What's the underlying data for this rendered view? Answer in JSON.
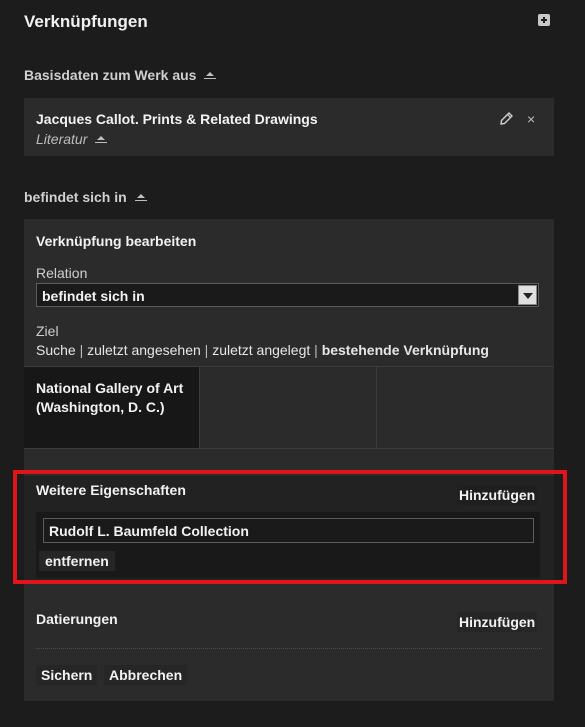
{
  "header": {
    "title": "Verknüpfungen"
  },
  "section1": {
    "label": "Basisdaten zum Werk aus",
    "item": {
      "title": "Jacques Callot. Prints & Related Drawings",
      "subtitle": "Literatur",
      "close": "×"
    }
  },
  "section2": {
    "label": "befindet sich in",
    "editor": {
      "title": "Verknüpfung bearbeiten",
      "relation_label": "Relation",
      "relation_value": "befindet sich in",
      "target_label": "Ziel",
      "links": [
        "Suche",
        "zuletzt angesehen",
        "zuletzt angelegt",
        "bestehende Verknüpfung"
      ],
      "separator": "|",
      "selected_result": "National Gallery of Art (Washington, D. C.)"
    },
    "weitere": {
      "title": "Weitere Eigenschaften",
      "add_label": "Hinzufügen",
      "value": "Rudolf L. Baumfeld Collection",
      "remove_label": "entfernen"
    },
    "datierungen": {
      "title": "Datierungen",
      "add_label": "Hinzufügen"
    },
    "actions": {
      "save": "Sichern",
      "cancel": "Abbrechen"
    }
  },
  "highlight_color": "#e0151b",
  "icons": [
    "plus-icon",
    "sort-icon",
    "pencil-icon",
    "close-icon",
    "dropdown-arrow-icon"
  ]
}
